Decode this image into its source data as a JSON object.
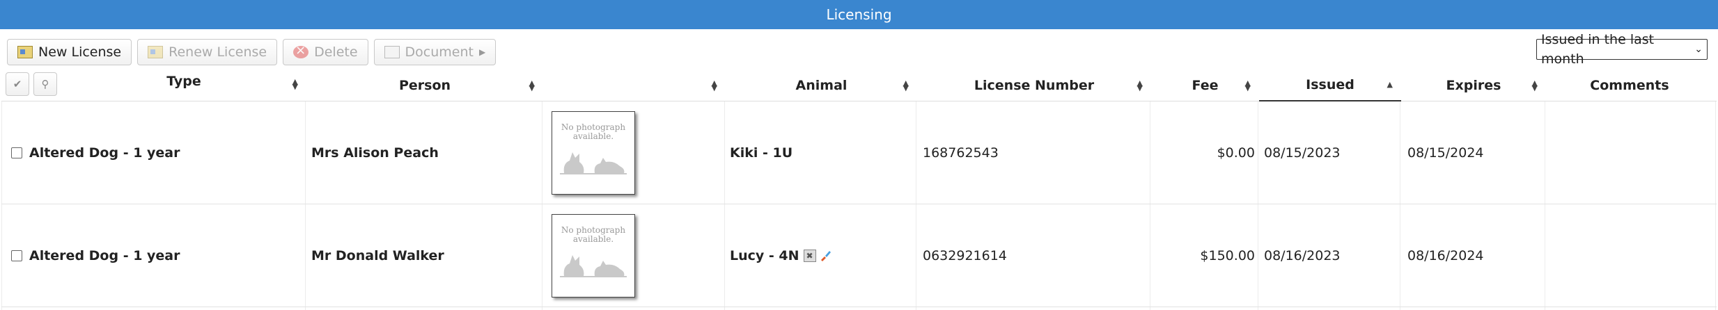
{
  "title": "Licensing",
  "toolbar": {
    "new_license": "New License",
    "renew_license": "Renew License",
    "delete": "Delete",
    "document": "Document"
  },
  "filter": {
    "selected": "Issued in the last month"
  },
  "columns": {
    "type": "Type",
    "person": "Person",
    "photo": "",
    "animal": "Animal",
    "license_number": "License Number",
    "fee": "Fee",
    "issued": "Issued",
    "expires": "Expires",
    "comments": "Comments"
  },
  "photo_placeholder": {
    "line1": "No photograph",
    "line2": "available."
  },
  "rows": [
    {
      "type": "Altered Dog - 1 year",
      "person": "Mrs Alison Peach",
      "animal": "Kiki - 1U",
      "license_number": "168762543",
      "fee": "$0.00",
      "issued": "08/15/2023",
      "expires": "08/15/2024",
      "comments": ""
    },
    {
      "type": "Altered Dog - 1 year",
      "person": "Mr Donald Walker",
      "animal": "Lucy - 4N",
      "license_number": "0632921614",
      "fee": "$150.00",
      "issued": "08/16/2023",
      "expires": "08/16/2024",
      "comments": ""
    }
  ],
  "colors": {
    "titlebar": "#3a86cf"
  }
}
